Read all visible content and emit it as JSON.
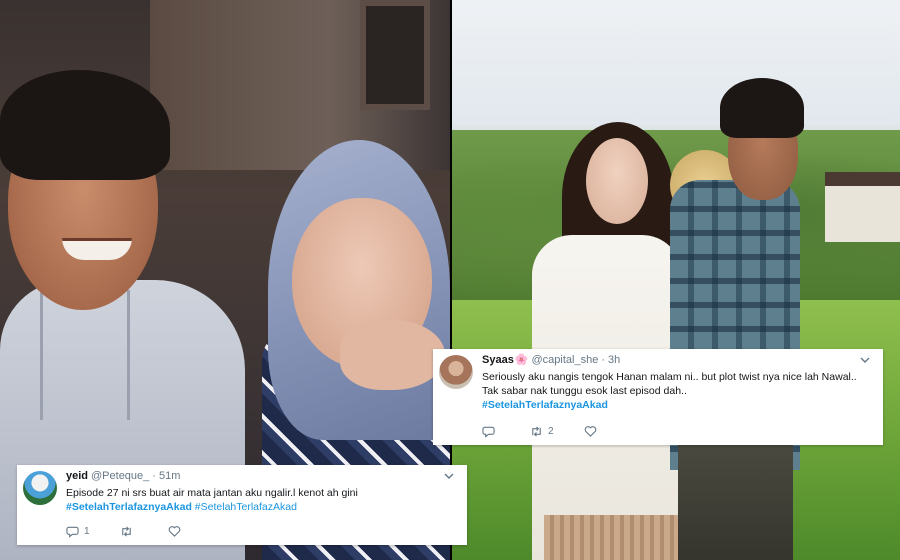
{
  "tweets": [
    {
      "name": "yeid",
      "handle": "@Peteque_",
      "separator": "·",
      "time": "51m",
      "text_lines": [
        "Episode 27 ni srs buat air mata jantan aku ngalir.l kenot ah gini"
      ],
      "hashtags": [
        "#SetelahTerlafaznyaAkad",
        "#SetelahTerlafazAkad"
      ],
      "actions": {
        "reply_count": "1",
        "retweet_count": "",
        "like_count": ""
      }
    },
    {
      "name": "Syaas",
      "name_emoji": "🌸",
      "handle": "@capital_she",
      "separator": "·",
      "time": "3h",
      "text_lines": [
        "Seriously aku nangis tengok Hanan malam ni.. but plot twist nya nice lah Nawal..",
        "Tak sabar nak tunggu esok last episod dah.."
      ],
      "hashtags": [
        "#SetelahTerlafaznyaAkad"
      ],
      "actions": {
        "reply_count": "",
        "retweet_count": "2",
        "like_count": ""
      }
    }
  ],
  "icons": {
    "reply": "reply-icon",
    "retweet": "retweet-icon",
    "like": "heart-icon",
    "caret": "chevron-down-icon"
  },
  "colors": {
    "hashtag": "#1b95e0",
    "meta_text": "#657786",
    "body_text": "#14171a"
  }
}
